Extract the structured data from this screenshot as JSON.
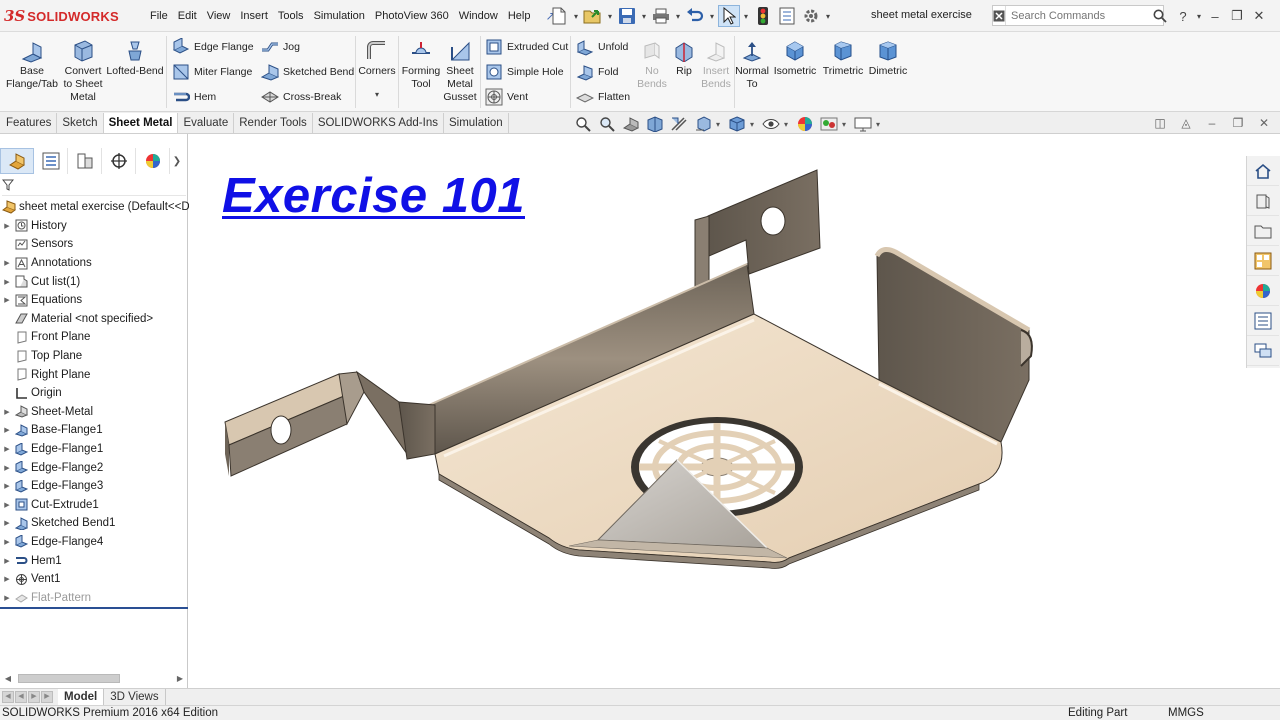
{
  "app": {
    "logo_ds": "3S",
    "logo_text": "SOLIDWORKS",
    "document_title": "sheet metal exercise"
  },
  "menu": [
    "File",
    "Edit",
    "View",
    "Insert",
    "Tools",
    "Simulation",
    "PhotoView 360",
    "Window",
    "Help"
  ],
  "search": {
    "placeholder": "Search Commands"
  },
  "toolbar": {
    "base_flange": "Base Flange/Tab",
    "convert": "Convert to Sheet Metal",
    "lofted_bend": "Lofted-Bend",
    "edge_flange": "Edge Flange",
    "miter_flange": "Miter Flange",
    "hem": "Hem",
    "jog": "Jog",
    "sketched_bend": "Sketched Bend",
    "cross_break": "Cross-Break",
    "corners": "Corners",
    "forming_tool": "Forming Tool",
    "sheet_metal_gusset": "Sheet Metal Gusset",
    "extruded_cut": "Extruded Cut",
    "simple_hole": "Simple Hole",
    "vent": "Vent",
    "unfold": "Unfold",
    "fold": "Fold",
    "flatten": "Flatten",
    "no_bends": "No Bends",
    "rip": "Rip",
    "insert_bends": "Insert Bends",
    "normal_to": "Normal To",
    "isometric": "Isometric",
    "trimetric": "Trimetric",
    "dimetric": "Dimetric"
  },
  "tabs": [
    {
      "label": "Features",
      "active": false
    },
    {
      "label": "Sketch",
      "active": false
    },
    {
      "label": "Sheet Metal",
      "active": true
    },
    {
      "label": "Evaluate",
      "active": false
    },
    {
      "label": "Render Tools",
      "active": false
    },
    {
      "label": "SOLIDWORKS Add-Ins",
      "active": false
    },
    {
      "label": "Simulation",
      "active": false
    }
  ],
  "tree": {
    "root": "sheet metal exercise  (Default<<D",
    "items": [
      {
        "label": "History",
        "icon": "history-icon",
        "expandable": true
      },
      {
        "label": "Sensors",
        "icon": "sensors-icon",
        "expandable": false
      },
      {
        "label": "Annotations",
        "icon": "annotations-icon",
        "expandable": true
      },
      {
        "label": "Cut list(1)",
        "icon": "cut-list-icon",
        "expandable": true
      },
      {
        "label": "Equations",
        "icon": "equations-icon",
        "expandable": true
      },
      {
        "label": "Material <not specified>",
        "icon": "material-icon",
        "expandable": false
      },
      {
        "label": "Front Plane",
        "icon": "plane-icon",
        "expandable": false
      },
      {
        "label": "Top Plane",
        "icon": "plane-icon",
        "expandable": false
      },
      {
        "label": "Right Plane",
        "icon": "plane-icon",
        "expandable": false
      },
      {
        "label": "Origin",
        "icon": "origin-icon",
        "expandable": false
      },
      {
        "label": "Sheet-Metal",
        "icon": "sheet-metal-icon",
        "expandable": true
      },
      {
        "label": "Base-Flange1",
        "icon": "base-flange-icon",
        "expandable": true
      },
      {
        "label": "Edge-Flange1",
        "icon": "edge-flange-icon",
        "expandable": true
      },
      {
        "label": "Edge-Flange2",
        "icon": "edge-flange-icon",
        "expandable": true
      },
      {
        "label": "Edge-Flange3",
        "icon": "edge-flange-icon",
        "expandable": true
      },
      {
        "label": "Cut-Extrude1",
        "icon": "cut-extrude-icon",
        "expandable": true
      },
      {
        "label": "Sketched Bend1",
        "icon": "sketched-bend-icon",
        "expandable": true
      },
      {
        "label": "Edge-Flange4",
        "icon": "edge-flange-icon",
        "expandable": true
      },
      {
        "label": "Hem1",
        "icon": "hem-icon",
        "expandable": true
      },
      {
        "label": "Vent1",
        "icon": "vent-icon",
        "expandable": true
      },
      {
        "label": "Flat-Pattern",
        "icon": "flat-pattern-icon",
        "expandable": true,
        "suppressed": true
      }
    ]
  },
  "graphics": {
    "banner": "Exercise 101"
  },
  "bottom_tabs": [
    {
      "label": "Model",
      "active": true
    },
    {
      "label": "3D Views",
      "active": false
    }
  ],
  "status": {
    "edition": "SOLIDWORKS Premium 2016 x64 Edition",
    "mode": "Editing Part",
    "units": "MMGS"
  },
  "colors": {
    "brand_red": "#d42a2a",
    "banner_blue": "#1010e6",
    "part_face": "#ecdcc6",
    "part_edge": "#8a7a68",
    "selection_blue": "#2a4f93"
  }
}
